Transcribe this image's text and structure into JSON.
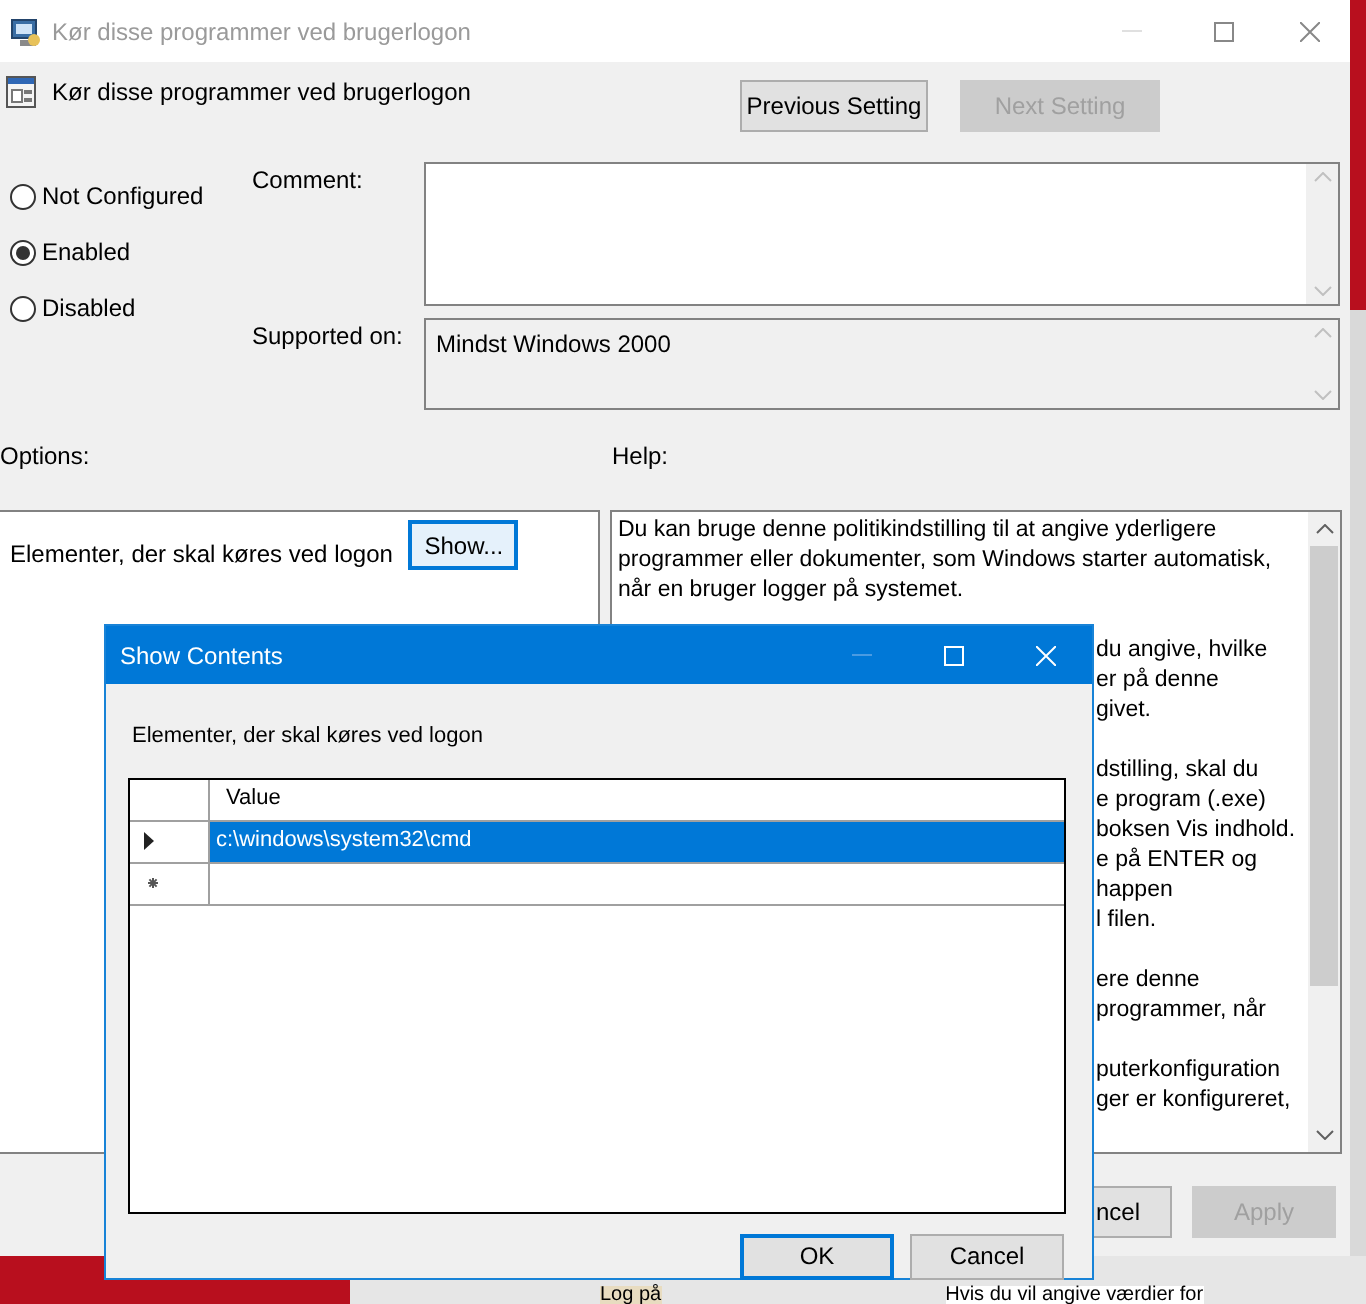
{
  "window": {
    "title": "Kør disse programmer ved brugerlogon"
  },
  "policy": {
    "title": "Kør disse programmer ved brugerlogon",
    "buttons": [
      {
        "label": "Previous Setting",
        "disabled": false
      },
      {
        "label": "Next Setting",
        "disabled": true
      }
    ]
  },
  "state_options": [
    {
      "label": "Not Configured",
      "selected": false
    },
    {
      "label": "Enabled",
      "selected": true
    },
    {
      "label": "Disabled",
      "selected": false
    }
  ],
  "comment": {
    "label": "Comment:"
  },
  "supported_on": {
    "label": "Supported on:",
    "value": "Mindst Windows 2000"
  },
  "options": {
    "heading": "Options:",
    "item_label": "Elementer, der skal køres ved logon",
    "button": "Show..."
  },
  "help": {
    "heading": "Help:",
    "paragraphs": [
      [
        {
          "text": "Du kan bruge denne politikindstilling til at angive yderligere",
          "kind": "full"
        },
        {
          "text": "programmer eller dokumenter, som Windows starter automatisk,",
          "kind": "full"
        },
        {
          "text": "når en bruger logger på systemet.",
          "kind": "full"
        }
      ],
      [
        {
          "text": "du angive, hvilke",
          "kind": "partial"
        },
        {
          "text": "er på denne",
          "kind": "partial"
        },
        {
          "text": "givet.",
          "kind": "partial"
        }
      ],
      [
        {
          "text": "dstilling, skal du",
          "kind": "partial"
        },
        {
          "text": "e program (.exe)",
          "kind": "partial"
        },
        {
          "text": "boksen Vis indhold.",
          "kind": "partial"
        },
        {
          "text": "e på ENTER og",
          "kind": "partial"
        },
        {
          "text": "happen",
          "kind": "partial"
        },
        {
          "text": "l filen.",
          "kind": "partial"
        }
      ],
      [
        {
          "text": "ere denne",
          "kind": "partial"
        },
        {
          "text": "programmer, når",
          "kind": "partial"
        }
      ],
      [
        {
          "text": "puterkonfiguration",
          "kind": "partial"
        },
        {
          "text": "ger er konfigureret,",
          "kind": "partial"
        }
      ]
    ]
  },
  "footer_buttons": [
    {
      "label": "ncel",
      "disabled": false
    },
    {
      "label": "Apply",
      "disabled": true
    }
  ],
  "dialog": {
    "title": "Show Contents",
    "label": "Elementer, der skal køres ved logon",
    "column": "Value",
    "rows": [
      {
        "value": "c:\\windows\\system32\\cmd",
        "selected": true
      }
    ],
    "buttons": [
      {
        "label": "OK",
        "default": true
      },
      {
        "label": "Cancel",
        "default": false
      }
    ]
  },
  "background_texts": [
    "Log på",
    "Hvis du vil angive værdier for"
  ]
}
